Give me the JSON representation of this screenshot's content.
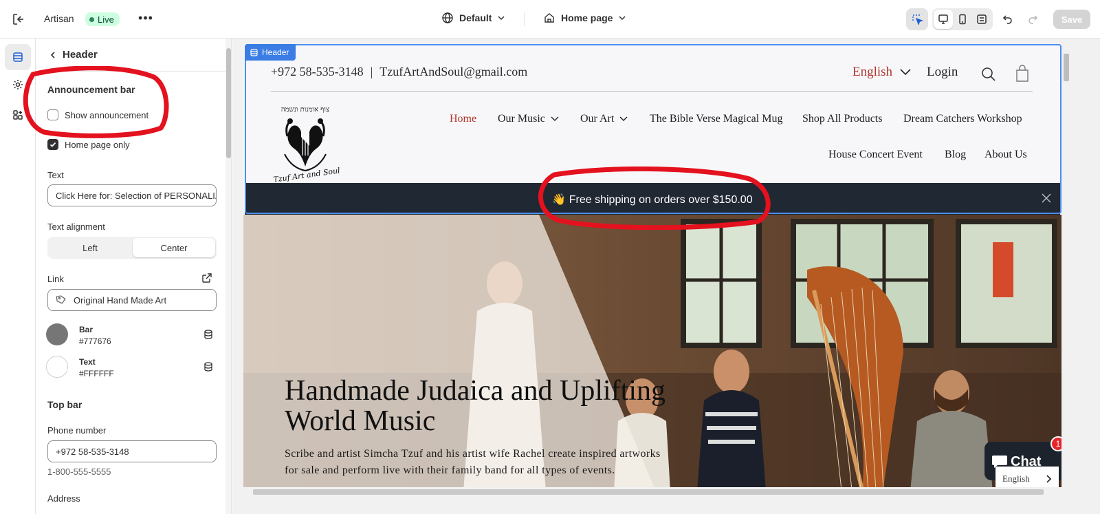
{
  "topbar": {
    "store_name": "Artisan",
    "status": "Live",
    "theme_select": "Default",
    "page_select": "Home page",
    "save_label": "Save"
  },
  "panel": {
    "title": "Header",
    "announcement": {
      "section_title": "Announcement bar",
      "show_label": "Show announcement",
      "show_checked": false,
      "homepage_label": "Home page only",
      "homepage_checked": true,
      "text_label": "Text",
      "text_value": "Click Here for: Selection of PERSONALIZED GIFTS",
      "align_label": "Text alignment",
      "align_options": [
        "Left",
        "Center"
      ],
      "align_selected": "Center",
      "link_label": "Link",
      "link_value": "Original Hand Made Art",
      "colors": [
        {
          "name": "Bar",
          "hex": "#777676"
        },
        {
          "name": "Text",
          "hex": "#FFFFFF"
        }
      ]
    },
    "topbar_section": {
      "section_title": "Top bar",
      "phone_label": "Phone number",
      "phone_value": "+972 58-535-3148",
      "phone_hint": "1-800-555-5555",
      "address_label": "Address"
    }
  },
  "preview": {
    "header_tag": "Header",
    "phone": "+972 58-535-3148",
    "email": "TzufArtAndSoul@gmail.com",
    "separator": "|",
    "language": "English",
    "login": "Login",
    "logo_caption": "Tzuf Art and Soul",
    "nav": [
      {
        "label": "Home",
        "active": true
      },
      {
        "label": "Our Music",
        "dropdown": true
      },
      {
        "label": "Our Art",
        "dropdown": true
      },
      {
        "label": "The Bible Verse Magical Mug"
      },
      {
        "label": "Shop All Products"
      },
      {
        "label": "Dream Catchers Workshop"
      },
      {
        "label": "House Concert Event"
      },
      {
        "label": "Blog"
      },
      {
        "label": "About Us"
      }
    ],
    "announcement_text": "👋 Free shipping on orders over $150.00",
    "hero_title": "Handmade Judaica and Uplifting World Music",
    "hero_body": "Scribe and artist Simcha Tzuf and his artist wife Rachel create inspired artworks for sale and perform live with their family band for all types of events.",
    "chat_label": "Chat",
    "chat_badge": "1",
    "lang_pill": "English"
  },
  "colors": {
    "announcement_bg": "#202833",
    "nav_active": "#b0352c",
    "selection_blue": "#3b7de4",
    "marker_red": "#e3121e"
  }
}
